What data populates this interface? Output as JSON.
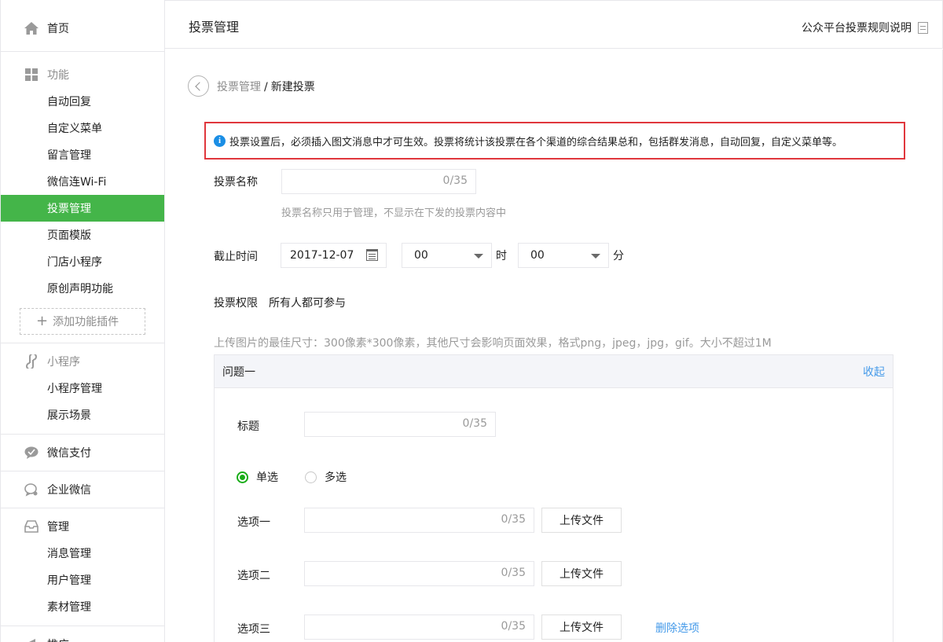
{
  "sidebar": {
    "home": "首页",
    "function": {
      "title": "功能",
      "items": [
        "自动回复",
        "自定义菜单",
        "留言管理",
        "微信连Wi-Fi",
        "投票管理",
        "页面模版",
        "门店小程序",
        "原创声明功能"
      ],
      "active": "投票管理",
      "add_plugin": "添加功能插件"
    },
    "miniprogram": {
      "title": "小程序",
      "items": [
        "小程序管理",
        "展示场景"
      ]
    },
    "pay": "微信支付",
    "work": "企业微信",
    "manage": {
      "title": "管理",
      "items": [
        "消息管理",
        "用户管理",
        "素材管理"
      ]
    },
    "promote": "推广"
  },
  "header": {
    "title": "投票管理",
    "rules_link": "公众平台投票规则说明"
  },
  "breadcrumb": {
    "parent": "投票管理",
    "separator": "/",
    "current": "新建投票"
  },
  "notice": "投票设置后，必须插入图文消息中才可生效。投票将统计该投票在各个渠道的综合结果总和，包括群发消息，自动回复，自定义菜单等。",
  "form": {
    "name_label": "投票名称",
    "name_counter": "0/35",
    "name_hint": "投票名称只用于管理，不显示在下发的投票内容中",
    "deadline_label": "截止时间",
    "date_value": "2017-12-07",
    "hour_value": "00",
    "hour_unit": "时",
    "minute_value": "00",
    "minute_unit": "分",
    "permission_label": "投票权限",
    "permission_value": "所有人都可参与",
    "upload_hint": "上传图片的最佳尺寸：300像素*300像素，其他尺寸会影响页面效果，格式png，jpeg，jpg，gif。大小不超过1M"
  },
  "question": {
    "title": "问题一",
    "collapse": "收起",
    "title_label": "标题",
    "title_counter": "0/35",
    "single": "单选",
    "multi": "多选",
    "options": [
      {
        "label": "选项一",
        "counter": "0/35",
        "upload": "上传文件"
      },
      {
        "label": "选项二",
        "counter": "0/35",
        "upload": "上传文件"
      },
      {
        "label": "选项三",
        "counter": "0/35",
        "upload": "上传文件",
        "delete": "删除选项"
      }
    ]
  },
  "colors": {
    "accent": "#44b549",
    "notice_border": "#e0373d",
    "link": "#459ae9",
    "radio": "#1aad19"
  }
}
